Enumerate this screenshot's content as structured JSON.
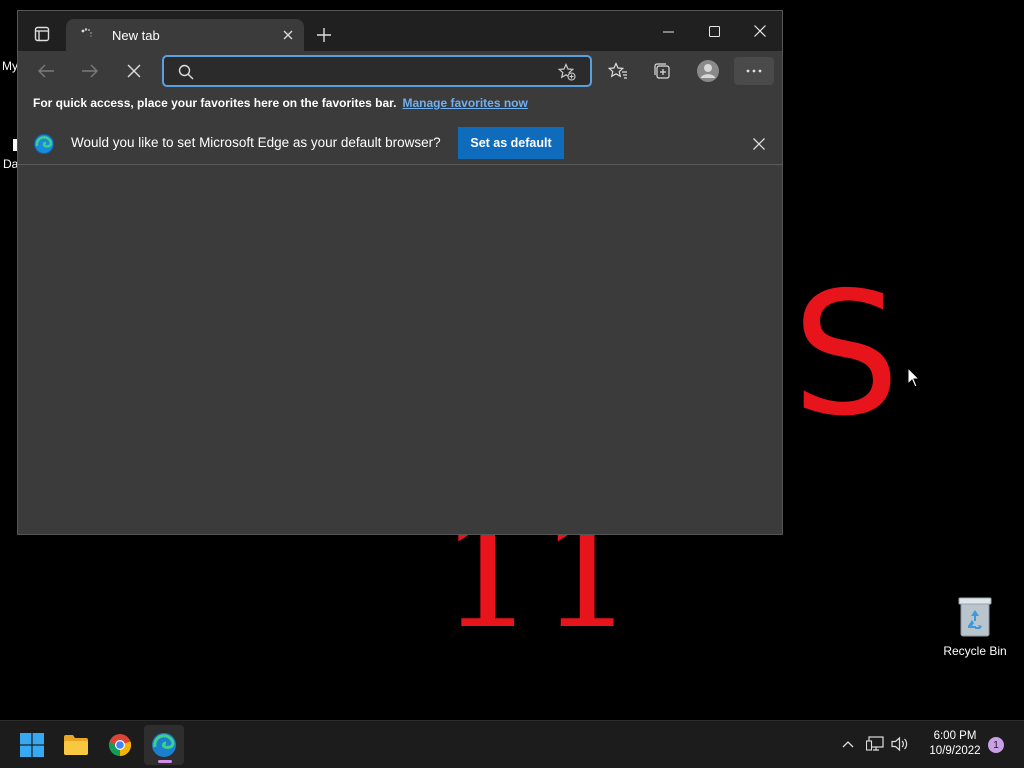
{
  "desktop": {
    "wallpaper_fragment_top": "S",
    "wallpaper_fragment_bottom": "11",
    "left_icon_label_1": "My",
    "left_icon_label_2": "Da",
    "recycle_bin_label": "Recycle Bin"
  },
  "browser": {
    "tab_title": "New tab",
    "address_value": "",
    "address_placeholder": "",
    "favorites_bar_text": "For quick access, place your favorites here on the favorites bar.",
    "favorites_bar_link": "Manage favorites now",
    "infobar_message": "Would you like to set Microsoft Edge as your default browser?",
    "infobar_button": "Set as default",
    "accent_color": "#0f6cbd"
  },
  "taskbar": {
    "time": "6:00 PM",
    "date": "10/9/2022",
    "notification_count": "1",
    "apps": [
      "start-icon",
      "file-explorer-icon",
      "chrome-icon",
      "edge-icon"
    ]
  },
  "colors": {
    "wallpaper_text": "#e8141c",
    "window_bg": "#3b3b3b",
    "titlebar_bg": "#202020"
  }
}
